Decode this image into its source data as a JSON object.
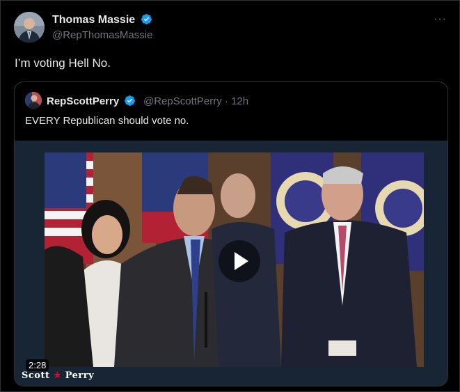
{
  "tweet": {
    "author_name": "Thomas Massie",
    "author_handle": "@RepThomasMassie",
    "text": "I’m voting Hell No.",
    "more_icon": "more-icon",
    "verified_icon": "verified-badge-icon"
  },
  "quoted_tweet": {
    "author_name": "RepScottPerry",
    "author_handle": "@RepScottPerry · 12h",
    "text": "EVERY Republican should vote no.",
    "video": {
      "duration": "2:28",
      "watermark_left": "Scott",
      "watermark_star": "★",
      "watermark_right": "Perry",
      "play_icon": "play-icon"
    }
  },
  "colors": {
    "background": "#000000",
    "text_primary": "#e7e9ea",
    "text_secondary": "#71767b",
    "border": "#2f3336",
    "verified_blue": "#1d9bf0",
    "media_bg": "#172535"
  }
}
